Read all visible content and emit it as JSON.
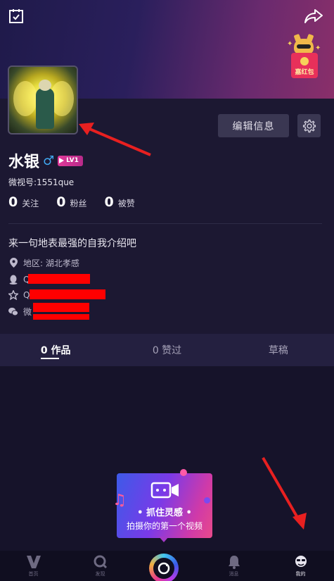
{
  "profile": {
    "username": "水银",
    "gender_symbol": "♂",
    "level": "LV1",
    "weishi_id": "微视号:1551que",
    "edit_label": "编辑信息",
    "bio": "来一句地表最强的自我介绍吧",
    "location": "地区: 湖北孝感",
    "qq_prefix": "Q",
    "qq2_prefix": "Q",
    "wechat_prefix": "微"
  },
  "stats": [
    {
      "count": "0",
      "label": "关注"
    },
    {
      "count": "0",
      "label": "粉丝"
    },
    {
      "count": "0",
      "label": "被赞"
    }
  ],
  "red_packet": {
    "label": "嘉红包"
  },
  "tabs": [
    {
      "label": "0 作品"
    },
    {
      "label": "0 赞过"
    },
    {
      "label": "草稿"
    }
  ],
  "promo": {
    "title": "• 抓住灵感 •",
    "subtitle": "拍摄你的第一个视频"
  },
  "bottom_nav": [
    {
      "label": "首页",
      "icon": "home-v-icon"
    },
    {
      "label": "发现",
      "icon": "discover-icon"
    },
    {
      "label": "",
      "icon": "camera-icon"
    },
    {
      "label": "消息",
      "icon": "bell-icon"
    },
    {
      "label": "我的",
      "icon": "me-icon"
    }
  ],
  "colors": {
    "background": "#1a1730",
    "accent_pink": "#e03a9a",
    "gender_blue": "#40a8f0",
    "redaction": "#ff0000",
    "annotation_arrow": "#e82020"
  }
}
